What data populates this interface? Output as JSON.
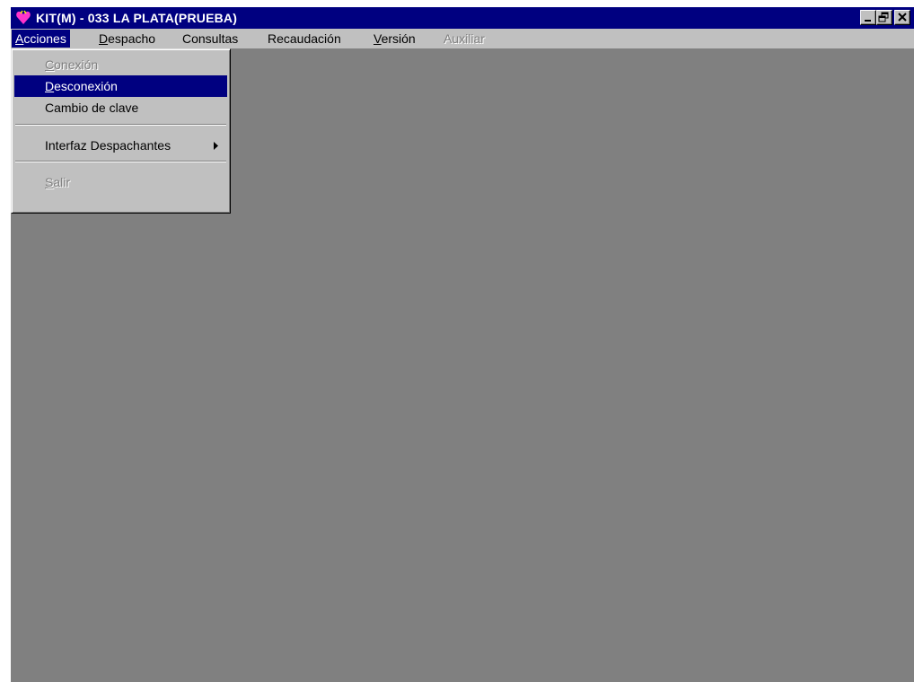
{
  "window": {
    "title": "KIT(M) - 033 LA PLATA(PRUEBA)",
    "icon": "heart-app-icon",
    "controls": [
      "minimize-icon",
      "restore-icon",
      "close-icon"
    ]
  },
  "menubar": {
    "items": [
      {
        "label": "Acciones",
        "mnemonic": "A",
        "rest": "cciones",
        "state": "open"
      },
      {
        "label": "Despacho",
        "mnemonic": "D",
        "rest": "espacho",
        "state": "normal"
      },
      {
        "label": "Consultas",
        "state": "normal"
      },
      {
        "label": "Recaudación",
        "state": "normal"
      },
      {
        "label": "Versión",
        "mnemonic": "V",
        "rest": "ersión",
        "state": "normal"
      },
      {
        "label": "Auxiliar",
        "state": "disabled"
      }
    ]
  },
  "acciones_menu": {
    "items": [
      {
        "label": "Conexión",
        "mnemonic": "C",
        "rest": "onexión",
        "state": "disabled"
      },
      {
        "label": "Desconexión",
        "mnemonic": "D",
        "rest": "esconexión",
        "state": "highlighted"
      },
      {
        "label": "Cambio de clave",
        "state": "normal"
      },
      {
        "label": "Interfaz Despachantes",
        "state": "normal",
        "has_submenu": true
      },
      {
        "label": "Salir",
        "mnemonic": "S",
        "rest": "alir",
        "state": "disabled"
      }
    ]
  },
  "colors": {
    "titlebar": "#000080",
    "highlight": "#000080",
    "face": "#c0c0c0",
    "workspace": "#808080",
    "disabled_text": "#808080"
  }
}
